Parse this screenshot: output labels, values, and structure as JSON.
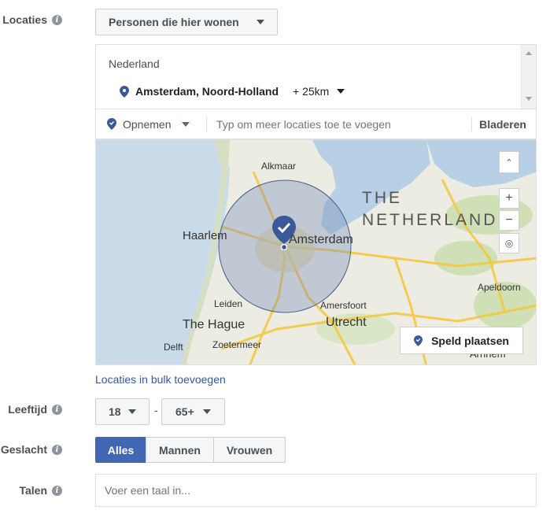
{
  "locaties": {
    "label": "Locaties",
    "audience_dropdown": "Personen die hier wonen",
    "country": "Nederland",
    "selected_location": "Amsterdam, Noord-Holland",
    "radius": "+ 25km",
    "include_dropdown": "Opnemen",
    "search_placeholder": "Typ om meer locaties toe te voegen",
    "browse_label": "Bladeren",
    "bulk_link": "Locaties in bulk toevoegen",
    "drop_pin_button": "Speld plaatsen",
    "map": {
      "title": "THE NETHERLAND",
      "cities": [
        "Alkmaar",
        "Haarlem",
        "Amsterdam",
        "Leiden",
        "The Hague",
        "Delft",
        "Zoetermeer",
        "Amersfoort",
        "Utrecht",
        "Apeldoorn",
        "Arnhem"
      ]
    }
  },
  "leeftijd": {
    "label": "Leeftijd",
    "min": "18",
    "separator": "-",
    "max": "65+"
  },
  "geslacht": {
    "label": "Geslacht",
    "options": [
      "Alles",
      "Mannen",
      "Vrouwen"
    ],
    "selected": "Alles"
  },
  "talen": {
    "label": "Talen",
    "placeholder": "Voer een taal in..."
  },
  "colors": {
    "accent": "#4267b2",
    "link": "#365899",
    "pin": "#3b5998"
  },
  "icons": {
    "info": "i"
  }
}
